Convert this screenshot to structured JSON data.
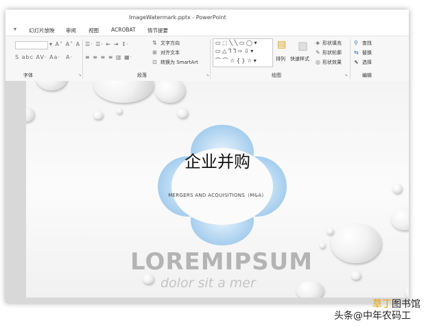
{
  "window": {
    "title": "ImageWatermark.pptx - PowerPoint"
  },
  "menu_tabs": [
    "幻灯片放映",
    "审阅",
    "视图",
    "ACROBAT",
    "情节提要"
  ],
  "ribbon": {
    "font_group": "字体",
    "paragraph_group": "段落",
    "drawing_group": "绘图",
    "editing_group": "编辑",
    "text_direction": "文字方向",
    "align_text": "对齐文本",
    "convert_smartart": "转换为 SmartArt",
    "arrange": "排列",
    "quick_styles": "快速样式",
    "shape_fill": "形状填充",
    "shape_outline": "形状轮廓",
    "shape_effects": "形状效果",
    "find": "查找",
    "replace": "替换",
    "select": "选择"
  },
  "slide": {
    "title": "企业并购",
    "subtitle": "MERGERS AND ACQUISITIONS（M&A）",
    "brand": "LOREMIPSUM",
    "tagline": "dolor sit a mer"
  },
  "watermark": {
    "line1_accent": "草丁",
    "line1_rest": "图书馆",
    "line2": "头条@中年农码工"
  },
  "colors": {
    "flower_blue": "#8fc3ec",
    "flower_light": "#d9ecfa"
  }
}
